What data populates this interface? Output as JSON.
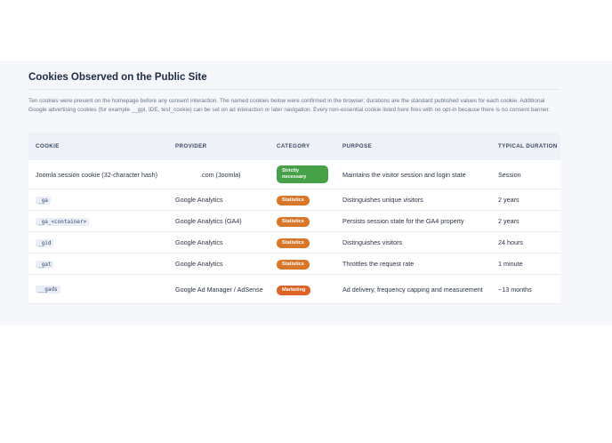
{
  "section": {
    "title": "Cookies Observed on the Public Site",
    "intro": "Ten cookies were present on the homepage before any consent interaction. The named cookies below were confirmed in the browser; durations are the standard published values for each cookie. Additional Google advertising cookies (for example __gpi, IDE, test_cookie) can be set on ad interaction or later navigation. Every non-essential cookie listed here fires with no opt-in because there is no consent banner."
  },
  "table": {
    "headers": [
      "COOKIE",
      "PROVIDER",
      "CATEGORY",
      "PURPOSE",
      "TYPICAL DURATION"
    ],
    "rows": [
      {
        "cookie": "Joomla session cookie (32-character hash)",
        "is_code": false,
        "provider": ".com (Joomla)",
        "category": "Strictly necessary",
        "category_color": "#47a148",
        "purpose": "Maintains the visitor session and login state",
        "duration": "Session"
      },
      {
        "cookie": "_ga",
        "is_code": true,
        "provider": "Google Analytics",
        "category": "Statistics",
        "category_color": "#d8762a",
        "purpose": "Distinguishes unique visitors",
        "duration": "2 years"
      },
      {
        "cookie": "_ga_<container>",
        "is_code": true,
        "provider": "Google Analytics (GA4)",
        "category": "Statistics",
        "category_color": "#d8762a",
        "purpose": "Persists session state for the GA4 property",
        "duration": "2 years"
      },
      {
        "cookie": "_gid",
        "is_code": true,
        "provider": "Google Analytics",
        "category": "Statistics",
        "category_color": "#d8762a",
        "purpose": "Distinguishes visitors",
        "duration": "24 hours"
      },
      {
        "cookie": "_gat",
        "is_code": true,
        "provider": "Google Analytics",
        "category": "Statistics",
        "category_color": "#d8762a",
        "purpose": "Throttles the request rate",
        "duration": "1 minute"
      },
      {
        "cookie": "__gads",
        "is_code": true,
        "provider": "Google Ad Manager / AdSense",
        "category": "Marketing",
        "category_color": "#de6327",
        "purpose": "Ad delivery, frequency capping and measurement",
        "duration": "~13 months"
      }
    ]
  }
}
